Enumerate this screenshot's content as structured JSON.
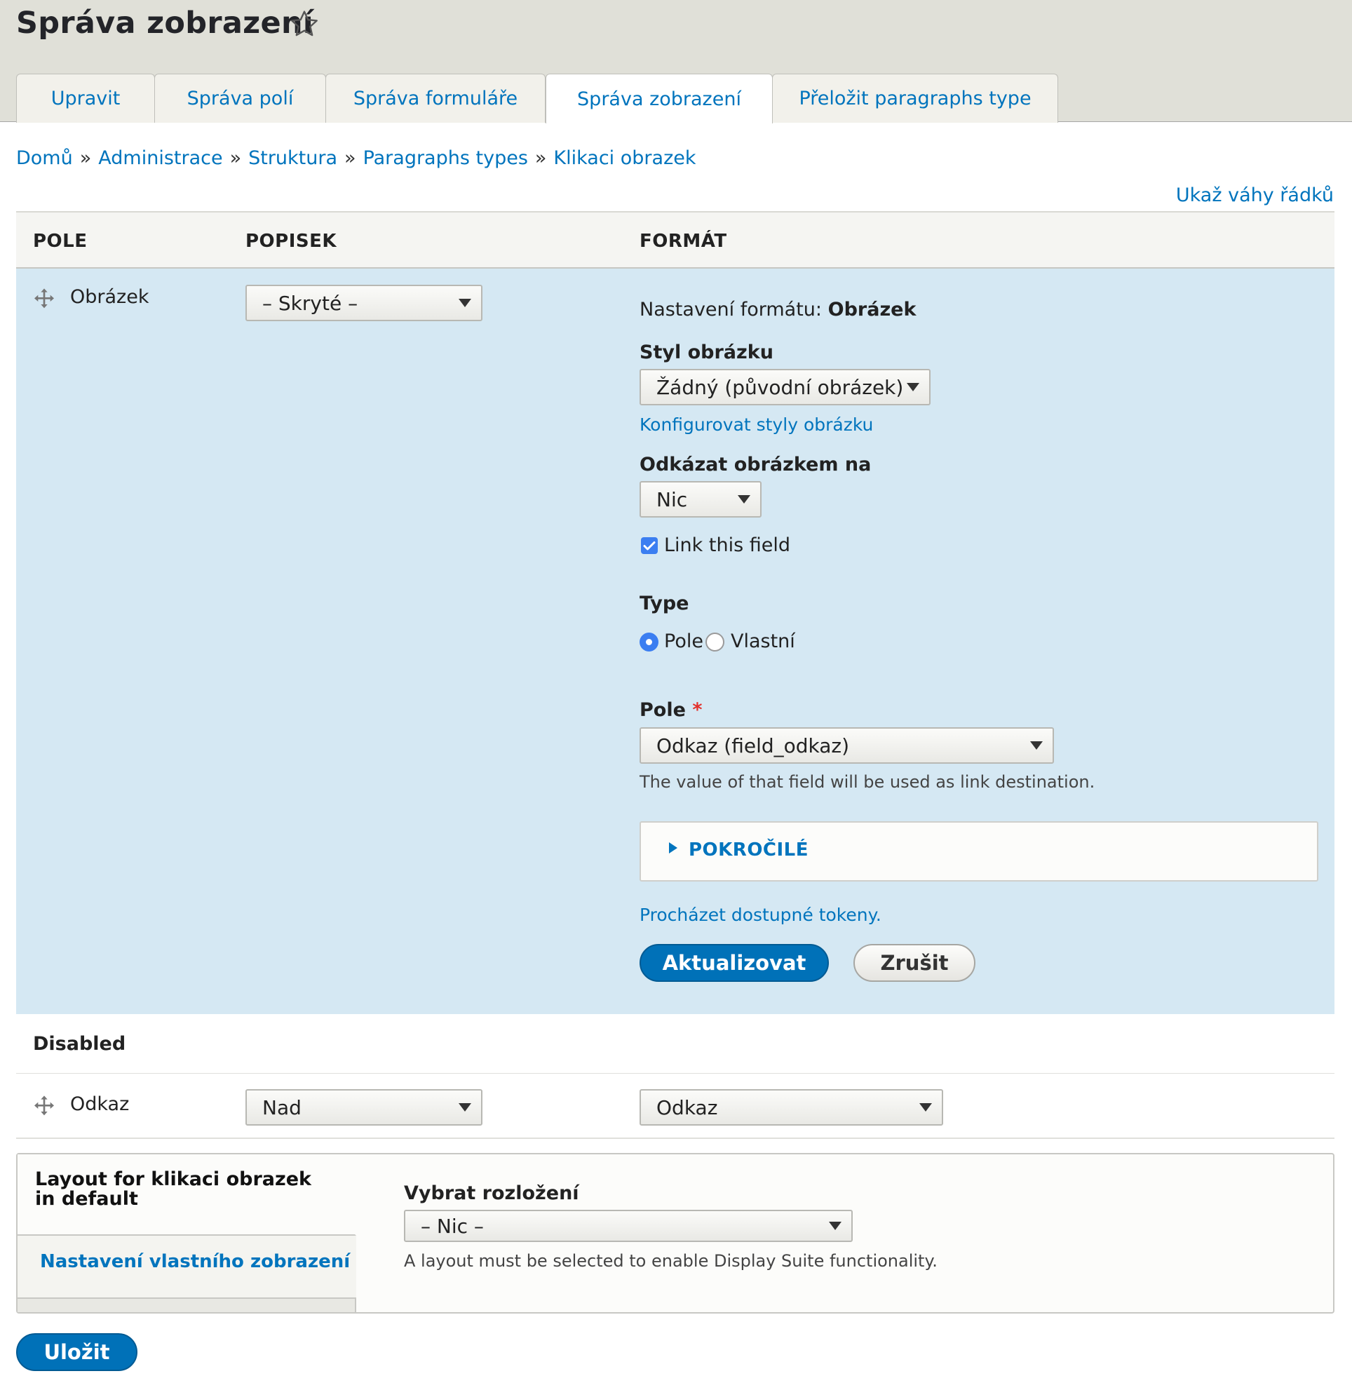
{
  "page": {
    "title": "Správa zobrazení",
    "favorite_icon": "star-outline-icon"
  },
  "tabs": [
    {
      "label": "Upravit"
    },
    {
      "label": "Správa polí"
    },
    {
      "label": "Správa formuláře"
    },
    {
      "label": "Správa zobrazení",
      "active": true
    },
    {
      "label": "Přeložit paragraphs type"
    }
  ],
  "breadcrumb": {
    "items": [
      "Domů",
      "Administrace",
      "Struktura",
      "Paragraphs types",
      "Klikaci obrazek"
    ],
    "separator": "»"
  },
  "row_weights_link": "Ukaž váhy řádků",
  "table": {
    "headers": {
      "field": "POLE",
      "label": "POPISEK",
      "format": "FORMÁT"
    },
    "image_row": {
      "drag_icon": "move-arrows-icon",
      "name": "Obrázek",
      "label_select": "– Skryté –",
      "format_settings_prefix": "Nastavení formátu:",
      "format_settings_name": "Obrázek",
      "image_style_label": "Styl obrázku",
      "image_style_value": "Žádný (původní obrázek)",
      "configure_styles_link": "Konfigurovat styly obrázku",
      "link_image_label": "Odkázat obrázkem na",
      "link_image_value": "Nic",
      "link_field_checkbox": "Link this field",
      "link_field_checked": true,
      "type_label": "Type",
      "type_options": [
        "Pole",
        "Vlastní"
      ],
      "type_selected": "Pole",
      "pole_label": "Pole",
      "pole_required": "*",
      "pole_value": "Odkaz (field_odkaz)",
      "pole_description": "The value of that field will be used as link destination.",
      "advanced_label": "POKROČILÉ",
      "tokens_link": "Procházet dostupné tokeny.",
      "update_button": "Aktualizovat",
      "cancel_button": "Zrušit"
    },
    "disabled_region": "Disabled",
    "link_row": {
      "drag_icon": "move-arrows-icon",
      "name": "Odkaz",
      "label_select": "Nad",
      "format_select": "Odkaz"
    }
  },
  "layout_box": {
    "tab_active": "Layout for klikaci obrazek in default",
    "tab_custom": "Nastavení vlastního zobrazení",
    "select_label": "Vybrat rozložení",
    "select_value": "– Nic –",
    "select_description": "A layout must be selected to enable Display Suite functionality."
  },
  "save_button": "Uložit",
  "colors": {
    "accent": "#0074bd",
    "primary_button": "#0071b8",
    "highlight_row": "#d5e8f3",
    "header_bg": "#e0e0d8"
  }
}
